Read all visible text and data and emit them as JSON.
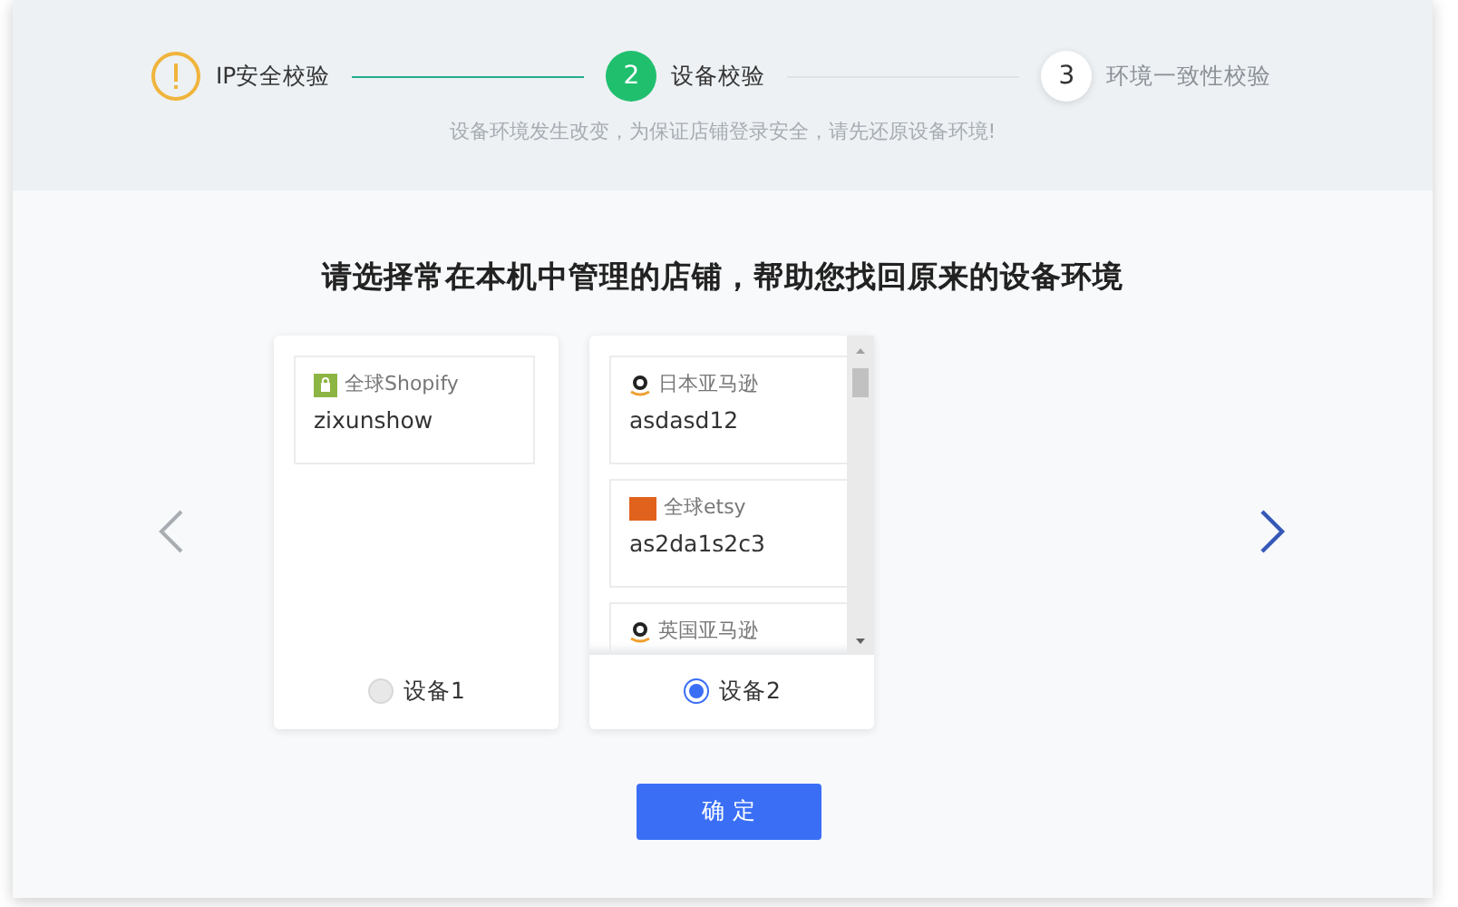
{
  "steps": [
    {
      "kind": "warning",
      "label": "IP安全校验"
    },
    {
      "kind": "active",
      "number": "2",
      "label": "设备校验"
    },
    {
      "kind": "pending",
      "number": "3",
      "label": "环境一致性校验"
    }
  ],
  "notice": "设备环境发生改变，为保证店铺登录安全，请先还原设备环境!",
  "heading": "请选择常在本机中管理的店铺，帮助您找回原来的设备环境",
  "devices": [
    {
      "label": "设备1",
      "selected": false,
      "scrollable": false,
      "stores": [
        {
          "kind": "shopify",
          "platform": "全球Shopify",
          "name": "zixunshow"
        }
      ]
    },
    {
      "label": "设备2",
      "selected": true,
      "scrollable": true,
      "stores": [
        {
          "kind": "amazon",
          "platform": "日本亚马逊",
          "name": "asdasd12"
        },
        {
          "kind": "etsy",
          "platform": "全球etsy",
          "name": "as2da1s2c3"
        },
        {
          "kind": "amazon",
          "platform": "英国亚马逊"
        }
      ]
    }
  ],
  "confirm_button": "确 定"
}
